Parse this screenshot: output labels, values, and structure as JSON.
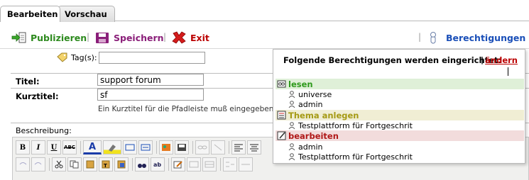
{
  "tabs": [
    {
      "label": "Bearbeiten",
      "active": true
    },
    {
      "label": "Vorschau",
      "active": false
    }
  ],
  "toolbar": {
    "publish": "Publizieren",
    "save": "Speichern",
    "exit": "Exit",
    "permissions": "Berechtigungen",
    "separator": "|"
  },
  "form": {
    "tags_label": "Tag(s):",
    "tags_value": "",
    "title_label": "Titel:",
    "title_value": "support forum",
    "shorttitle_label": "Kurztitel:",
    "shorttitle_value": "sf",
    "shorttitle_hint": "Ein Kurztitel für die Pfadleiste muß eingegeben wer",
    "description_label": "Beschreibung:"
  },
  "popup": {
    "heading": "Folgende Berechtigungen werden eingerichtet:",
    "separator": "|",
    "change_link": "ändern",
    "groups": [
      {
        "label": "lesen",
        "members": [
          "universe",
          "admin"
        ]
      },
      {
        "label": "Thema anlegen",
        "members": [
          "Testplattform für Fortgeschrit"
        ]
      },
      {
        "label": "bearbeiten",
        "members": [
          "admin",
          "Testplattform für Fortgeschrit"
        ]
      }
    ]
  },
  "editor": {
    "bold": "B",
    "italic": "I",
    "underline": "U",
    "strike": "ABC",
    "font_color": "A"
  },
  "colors": {
    "publish": "#2d8a1e",
    "save": "#8a1e79",
    "exit": "#bb0000",
    "permissions": "#1a4fb8",
    "lesen_bg": "#dff0d8",
    "thema_bg": "#f0eed4",
    "bearbeiten_bg": "#f2dcdc"
  },
  "icons": [
    "publish-icon",
    "save-icon",
    "exit-icon",
    "permissions-icon",
    "tag-icon",
    "user-icon"
  ]
}
